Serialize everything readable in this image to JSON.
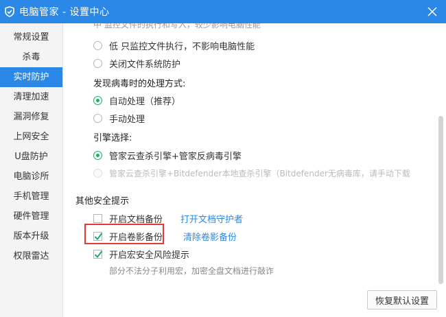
{
  "window": {
    "title": "电脑管家 - 设置中心",
    "colors": {
      "titlebar": "#2c88e6",
      "accent": "#2c88e6",
      "radio_on": "#1faa67",
      "highlight": "#e53935"
    }
  },
  "sidebar": {
    "active_index": 2,
    "items": [
      {
        "label": "常规设置"
      },
      {
        "label": "杀毒"
      },
      {
        "label": "实时防护"
      },
      {
        "label": "清理加速"
      },
      {
        "label": "漏洞修复"
      },
      {
        "label": "上网安全"
      },
      {
        "label": "U盘防护"
      },
      {
        "label": "电脑诊所"
      },
      {
        "label": "手机管理"
      },
      {
        "label": "硬件管理"
      },
      {
        "label": "版本升级"
      },
      {
        "label": "权限雷达"
      }
    ]
  },
  "content": {
    "cut_line": "中   监控文件的执行和写入，较少影响电脑性能",
    "monitor_options": [
      {
        "label": "低    只监控文件执行，不影响电脑性能",
        "selected": false
      },
      {
        "label": "关闭文件系统防护",
        "selected": false
      }
    ],
    "virus_handling": {
      "heading": "发现病毒时的处理方式:",
      "options": [
        {
          "label": "自动处理（推荐）",
          "selected": true
        },
        {
          "label": "手动处理",
          "selected": false
        }
      ]
    },
    "engine": {
      "heading": "引擎选择:",
      "options": [
        {
          "label": "管家云查杀引擎+管家反病毒引擎",
          "selected": true,
          "disabled": false
        },
        {
          "label": "管家云查杀引擎+Bitdefender本地查杀引擎（Bitdefender无病毒库，请手动下载",
          "selected": false,
          "disabled": true
        }
      ]
    },
    "other": {
      "heading": "其他安全提示",
      "doc_backup": {
        "label": "开启文档备份",
        "checked": false,
        "link": "打开文档守护者"
      },
      "shadow_backup": {
        "label": "开启卷影备份",
        "checked": true,
        "link": "清除卷影备份"
      },
      "macro": {
        "label": "开启宏安全风险提示",
        "checked": true,
        "note": "部分不法分子利用宏，加密全盘文档进行敲诈"
      }
    },
    "restore_label": "恢复默认设置"
  }
}
